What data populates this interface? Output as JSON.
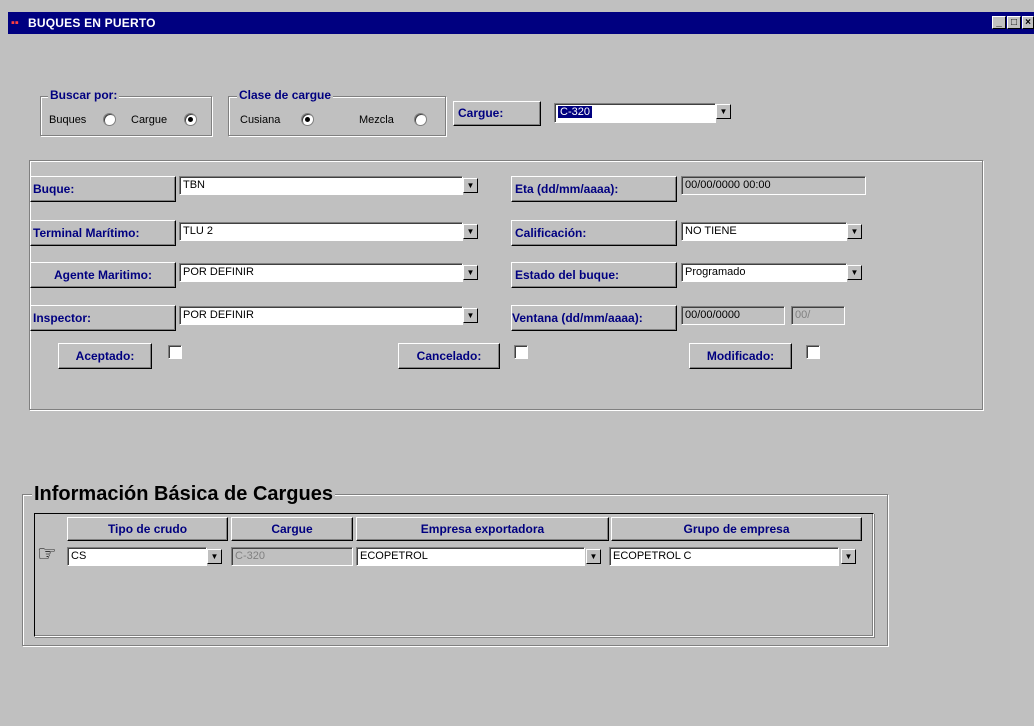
{
  "window": {
    "title": "BUQUES EN PUERTO",
    "min": "_",
    "max": "□",
    "close": "×"
  },
  "buscar": {
    "legend": "Buscar por:",
    "opt1": "Buques",
    "opt2": "Cargue",
    "selected": "Cargue"
  },
  "clase": {
    "legend": "Clase de cargue",
    "opt1": "Cusiana",
    "opt2": "Mezcla",
    "selected": "Cusiana"
  },
  "cargue_top": {
    "label": "Cargue:",
    "value": "C-320"
  },
  "form": {
    "buque_label": "Buque:",
    "buque_value": "TBN",
    "terminal_label": "Terminal Marítimo:",
    "terminal_value": "TLU 2",
    "agente_label": "Agente Maritimo:",
    "agente_value": "POR DEFINIR",
    "inspector_label": "Inspector:",
    "inspector_value": "POR DEFINIR",
    "eta_label": "Eta (dd/mm/aaaa):",
    "eta_value": "00/00/0000 00:00",
    "calificacion_label": "Calificación:",
    "calificacion_value": "NO TIENE",
    "estado_label": "Estado del buque:",
    "estado_value": "Programado",
    "ventana_label": "Ventana (dd/mm/aaaa):",
    "ventana_value": "00/00/0000",
    "ventana_value2": "00/",
    "aceptado_label": "Aceptado:",
    "cancelado_label": "Cancelado:",
    "modificado_label": "Modificado:"
  },
  "info": {
    "title": "Información Básica de Cargues",
    "headers": [
      "Tipo de crudo",
      "Cargue",
      "Empresa exportadora",
      "Grupo de empresa"
    ],
    "row": {
      "tipo": "CS",
      "cargue": "C-320",
      "empresa": "ECOPETROL",
      "grupo": "ECOPETROL C"
    }
  },
  "icons": {
    "dropdown": "▼",
    "pointer": "☞"
  }
}
